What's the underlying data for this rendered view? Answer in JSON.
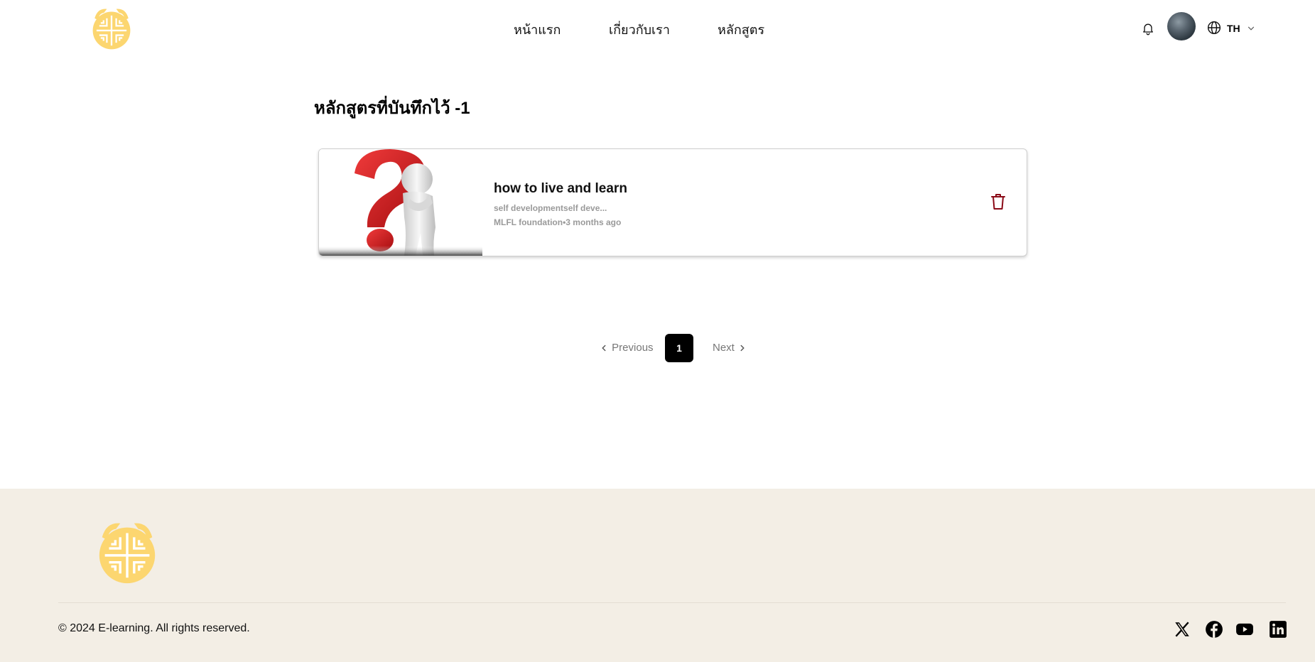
{
  "header": {
    "nav": [
      {
        "label": "หน้าแรก"
      },
      {
        "label": "เกี่ยวกับเรา"
      },
      {
        "label": "หลักสูตร"
      }
    ],
    "language": "TH",
    "icons": {
      "bell": "bell-icon",
      "globe": "globe-icon",
      "chevron": "chevron-down-icon"
    }
  },
  "main": {
    "title": "หลักสูตรที่บันทึกไว้ -1",
    "courses": [
      {
        "title": "how to live and learn",
        "description": "self developmentself deve...",
        "meta": "MLFL foundation•3 months ago"
      }
    ]
  },
  "pagination": {
    "previous": "Previous",
    "current": "1",
    "next": "Next"
  },
  "footer": {
    "copyright": "© 2024 E-learning. All rights reserved.",
    "social": [
      "x-icon",
      "facebook-icon",
      "youtube-icon",
      "linkedin-icon"
    ]
  },
  "colors": {
    "logo": "#fcd670",
    "footer_bg": "#f3eee5",
    "trash": "#8b0a17",
    "pagination_active": "#000000"
  }
}
